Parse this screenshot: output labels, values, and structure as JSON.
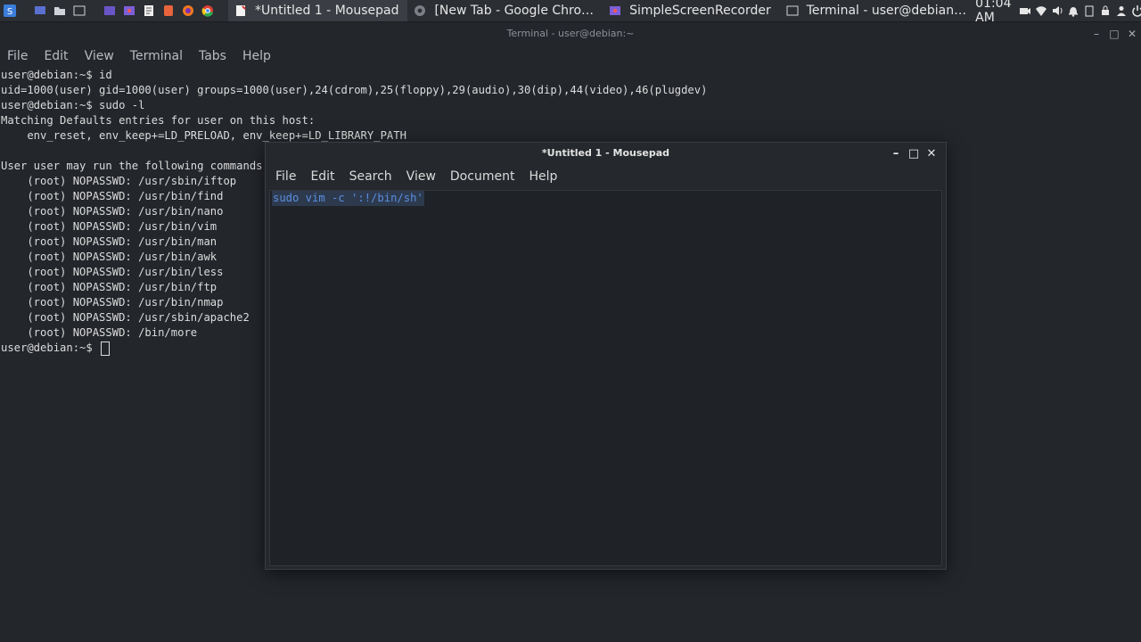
{
  "panel": {
    "tasks": [
      {
        "label": "*Untitled 1 - Mousepad",
        "active": true
      },
      {
        "label": "[New Tab - Google Chro…",
        "active": false
      },
      {
        "label": "SimpleScreenRecorder",
        "active": false
      },
      {
        "label": "Terminal - user@debian…",
        "active": false
      }
    ],
    "clock": "01:04 AM"
  },
  "terminal": {
    "title": "Terminal - user@debian:~",
    "menu": [
      "File",
      "Edit",
      "View",
      "Terminal",
      "Tabs",
      "Help"
    ],
    "lines": [
      "user@debian:~$ id",
      "uid=1000(user) gid=1000(user) groups=1000(user),24(cdrom),25(floppy),29(audio),30(dip),44(video),46(plugdev)",
      "user@debian:~$ sudo -l",
      "Matching Defaults entries for user on this host:",
      "    env_reset, env_keep+=LD_PRELOAD, env_keep+=LD_LIBRARY_PATH",
      "",
      "User user may run the following commands",
      "    (root) NOPASSWD: /usr/sbin/iftop",
      "    (root) NOPASSWD: /usr/bin/find",
      "    (root) NOPASSWD: /usr/bin/nano",
      "    (root) NOPASSWD: /usr/bin/vim",
      "    (root) NOPASSWD: /usr/bin/man",
      "    (root) NOPASSWD: /usr/bin/awk",
      "    (root) NOPASSWD: /usr/bin/less",
      "    (root) NOPASSWD: /usr/bin/ftp",
      "    (root) NOPASSWD: /usr/bin/nmap",
      "    (root) NOPASSWD: /usr/sbin/apache2",
      "    (root) NOPASSWD: /bin/more",
      "user@debian:~$ "
    ]
  },
  "mousepad": {
    "title": "*Untitled 1 - Mousepad",
    "menu": [
      "File",
      "Edit",
      "Search",
      "View",
      "Document",
      "Help"
    ],
    "content": "sudo vim -c ':!/bin/sh'"
  },
  "colors": {
    "panel_bg": "#2b2e33",
    "terminal_bg": "#23262b",
    "selection_text": "#5b8ee0",
    "selection_bg": "#2d3a4e"
  }
}
